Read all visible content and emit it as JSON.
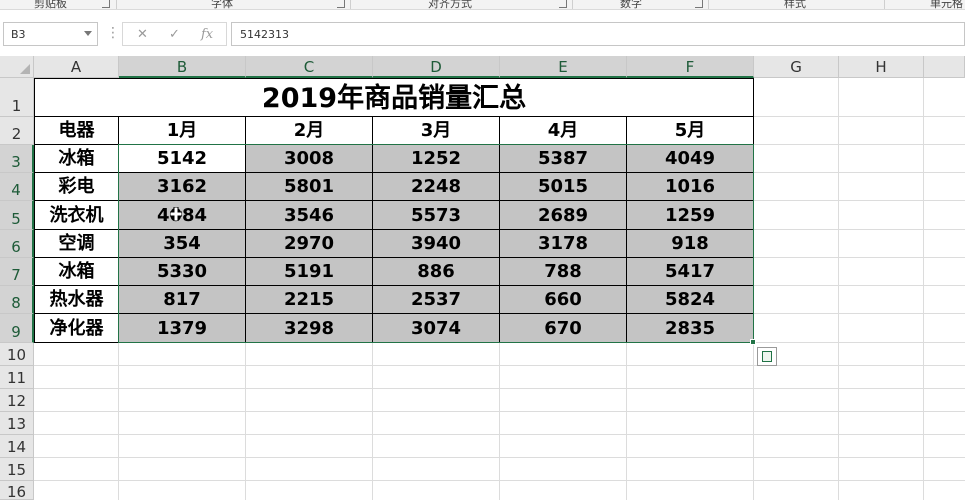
{
  "ribbon": {
    "groups": [
      "剪贴板",
      "字体",
      "对齐方式",
      "数字",
      "样式",
      "单元格"
    ]
  },
  "formula_bar": {
    "name_box": "B3",
    "formula": "5142313",
    "icons": [
      "cancel-icon",
      "enter-icon",
      "function-icon"
    ],
    "fx_label": "fx"
  },
  "sheet": {
    "columns": [
      "A",
      "B",
      "C",
      "D",
      "E",
      "F",
      "G",
      "H"
    ],
    "rows": [
      "1",
      "2",
      "3",
      "4",
      "5",
      "6",
      "7",
      "8",
      "9",
      "10",
      "11",
      "12",
      "13",
      "14",
      "15",
      "16"
    ],
    "selected_columns": [
      "B",
      "C",
      "D",
      "E",
      "F"
    ],
    "selected_rows": [
      "3",
      "4",
      "5",
      "6",
      "7",
      "8",
      "9"
    ]
  },
  "table": {
    "title": "2019年商品销量汇总",
    "header": [
      "电器",
      "1月",
      "2月",
      "3月",
      "4月",
      "5月"
    ],
    "rows": [
      [
        "冰箱",
        "5142",
        "3008",
        "1252",
        "5387",
        "4049"
      ],
      [
        "彩电",
        "3162",
        "5801",
        "2248",
        "5015",
        "1016"
      ],
      [
        "洗衣机",
        "4084",
        "3546",
        "5573",
        "2689",
        "1259"
      ],
      [
        "空调",
        "354",
        "2970",
        "3940",
        "3178",
        "918"
      ],
      [
        "冰箱",
        "5330",
        "5191",
        "886",
        "788",
        "5417"
      ],
      [
        "热水器",
        "817",
        "2215",
        "2537",
        "660",
        "5824"
      ],
      [
        "净化器",
        "1379",
        "3298",
        "3074",
        "670",
        "2835"
      ]
    ]
  },
  "colors": {
    "selection": "#217346",
    "selected_fill": "#c4c4c4",
    "header_bg": "#e6e6e6"
  }
}
